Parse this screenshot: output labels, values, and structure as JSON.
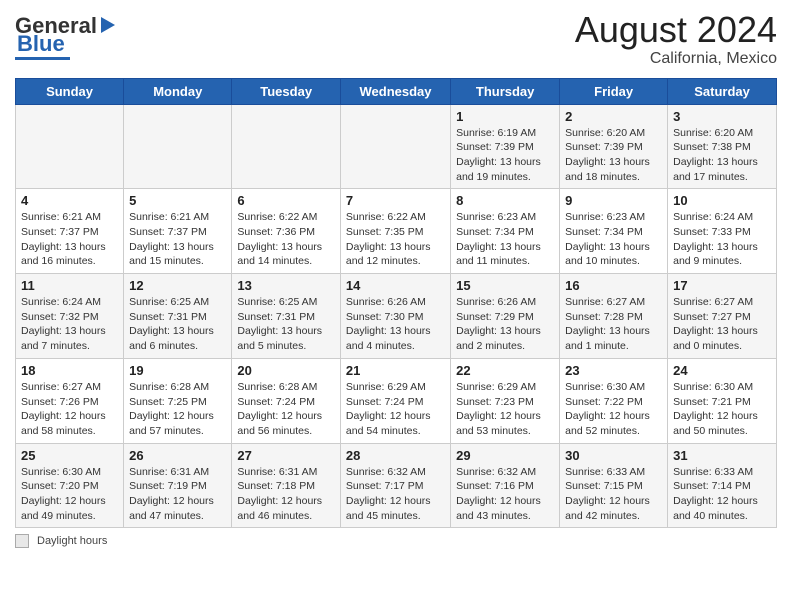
{
  "header": {
    "logo_general": "General",
    "logo_blue": "Blue",
    "month_year": "August 2024",
    "location": "California, Mexico"
  },
  "days_of_week": [
    "Sunday",
    "Monday",
    "Tuesday",
    "Wednesday",
    "Thursday",
    "Friday",
    "Saturday"
  ],
  "weeks": [
    [
      {
        "day": "",
        "info": ""
      },
      {
        "day": "",
        "info": ""
      },
      {
        "day": "",
        "info": ""
      },
      {
        "day": "",
        "info": ""
      },
      {
        "day": "1",
        "info": "Sunrise: 6:19 AM\nSunset: 7:39 PM\nDaylight: 13 hours\nand 19 minutes."
      },
      {
        "day": "2",
        "info": "Sunrise: 6:20 AM\nSunset: 7:39 PM\nDaylight: 13 hours\nand 18 minutes."
      },
      {
        "day": "3",
        "info": "Sunrise: 6:20 AM\nSunset: 7:38 PM\nDaylight: 13 hours\nand 17 minutes."
      }
    ],
    [
      {
        "day": "4",
        "info": "Sunrise: 6:21 AM\nSunset: 7:37 PM\nDaylight: 13 hours\nand 16 minutes."
      },
      {
        "day": "5",
        "info": "Sunrise: 6:21 AM\nSunset: 7:37 PM\nDaylight: 13 hours\nand 15 minutes."
      },
      {
        "day": "6",
        "info": "Sunrise: 6:22 AM\nSunset: 7:36 PM\nDaylight: 13 hours\nand 14 minutes."
      },
      {
        "day": "7",
        "info": "Sunrise: 6:22 AM\nSunset: 7:35 PM\nDaylight: 13 hours\nand 12 minutes."
      },
      {
        "day": "8",
        "info": "Sunrise: 6:23 AM\nSunset: 7:34 PM\nDaylight: 13 hours\nand 11 minutes."
      },
      {
        "day": "9",
        "info": "Sunrise: 6:23 AM\nSunset: 7:34 PM\nDaylight: 13 hours\nand 10 minutes."
      },
      {
        "day": "10",
        "info": "Sunrise: 6:24 AM\nSunset: 7:33 PM\nDaylight: 13 hours\nand 9 minutes."
      }
    ],
    [
      {
        "day": "11",
        "info": "Sunrise: 6:24 AM\nSunset: 7:32 PM\nDaylight: 13 hours\nand 7 minutes."
      },
      {
        "day": "12",
        "info": "Sunrise: 6:25 AM\nSunset: 7:31 PM\nDaylight: 13 hours\nand 6 minutes."
      },
      {
        "day": "13",
        "info": "Sunrise: 6:25 AM\nSunset: 7:31 PM\nDaylight: 13 hours\nand 5 minutes."
      },
      {
        "day": "14",
        "info": "Sunrise: 6:26 AM\nSunset: 7:30 PM\nDaylight: 13 hours\nand 4 minutes."
      },
      {
        "day": "15",
        "info": "Sunrise: 6:26 AM\nSunset: 7:29 PM\nDaylight: 13 hours\nand 2 minutes."
      },
      {
        "day": "16",
        "info": "Sunrise: 6:27 AM\nSunset: 7:28 PM\nDaylight: 13 hours\nand 1 minute."
      },
      {
        "day": "17",
        "info": "Sunrise: 6:27 AM\nSunset: 7:27 PM\nDaylight: 13 hours\nand 0 minutes."
      }
    ],
    [
      {
        "day": "18",
        "info": "Sunrise: 6:27 AM\nSunset: 7:26 PM\nDaylight: 12 hours\nand 58 minutes."
      },
      {
        "day": "19",
        "info": "Sunrise: 6:28 AM\nSunset: 7:25 PM\nDaylight: 12 hours\nand 57 minutes."
      },
      {
        "day": "20",
        "info": "Sunrise: 6:28 AM\nSunset: 7:24 PM\nDaylight: 12 hours\nand 56 minutes."
      },
      {
        "day": "21",
        "info": "Sunrise: 6:29 AM\nSunset: 7:24 PM\nDaylight: 12 hours\nand 54 minutes."
      },
      {
        "day": "22",
        "info": "Sunrise: 6:29 AM\nSunset: 7:23 PM\nDaylight: 12 hours\nand 53 minutes."
      },
      {
        "day": "23",
        "info": "Sunrise: 6:30 AM\nSunset: 7:22 PM\nDaylight: 12 hours\nand 52 minutes."
      },
      {
        "day": "24",
        "info": "Sunrise: 6:30 AM\nSunset: 7:21 PM\nDaylight: 12 hours\nand 50 minutes."
      }
    ],
    [
      {
        "day": "25",
        "info": "Sunrise: 6:30 AM\nSunset: 7:20 PM\nDaylight: 12 hours\nand 49 minutes."
      },
      {
        "day": "26",
        "info": "Sunrise: 6:31 AM\nSunset: 7:19 PM\nDaylight: 12 hours\nand 47 minutes."
      },
      {
        "day": "27",
        "info": "Sunrise: 6:31 AM\nSunset: 7:18 PM\nDaylight: 12 hours\nand 46 minutes."
      },
      {
        "day": "28",
        "info": "Sunrise: 6:32 AM\nSunset: 7:17 PM\nDaylight: 12 hours\nand 45 minutes."
      },
      {
        "day": "29",
        "info": "Sunrise: 6:32 AM\nSunset: 7:16 PM\nDaylight: 12 hours\nand 43 minutes."
      },
      {
        "day": "30",
        "info": "Sunrise: 6:33 AM\nSunset: 7:15 PM\nDaylight: 12 hours\nand 42 minutes."
      },
      {
        "day": "31",
        "info": "Sunrise: 6:33 AM\nSunset: 7:14 PM\nDaylight: 12 hours\nand 40 minutes."
      }
    ]
  ],
  "footer": {
    "legend_label": "Daylight hours"
  }
}
